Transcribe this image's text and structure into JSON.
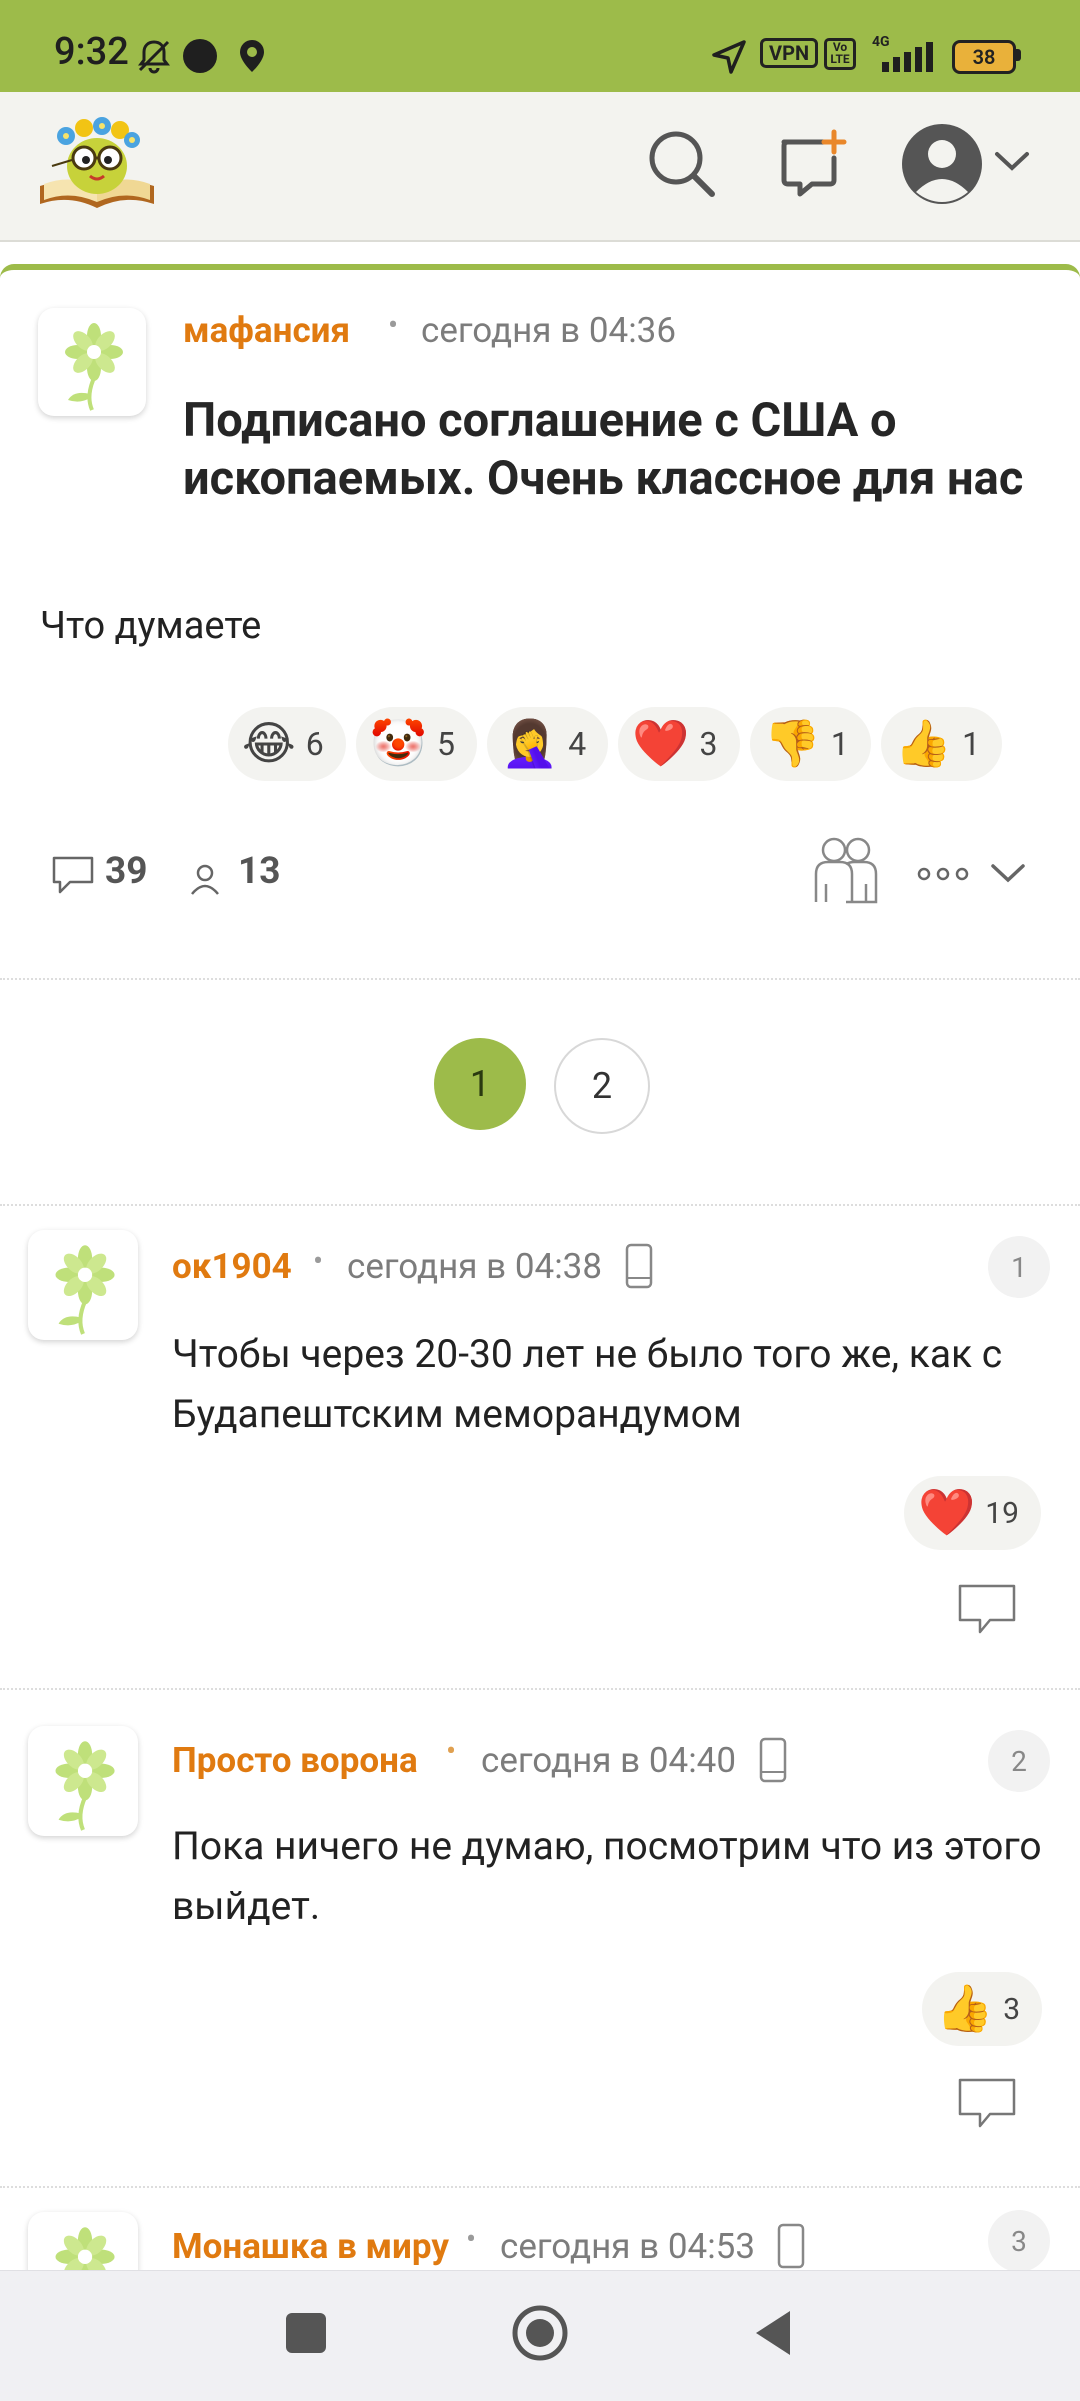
{
  "status_bar": {
    "time": "9:32",
    "vpn": "VPN",
    "volte": "Vo LTE",
    "network": "4G",
    "battery": "38"
  },
  "post": {
    "author": "мафансия",
    "time": "сегодня в 04:36",
    "title": "Подписано соглашение с США о ископаемых. Очень классное для нас",
    "body": "Что думаете",
    "reactions": [
      {
        "emoji": "😂",
        "count": "6"
      },
      {
        "emoji": "🤡",
        "count": "5"
      },
      {
        "emoji": "🤦‍♀️",
        "count": "4"
      },
      {
        "emoji": "❤️",
        "count": "3"
      },
      {
        "emoji": "👎",
        "count": "1"
      },
      {
        "emoji": "👍",
        "count": "1"
      }
    ],
    "comments_count": "39",
    "subscribers_count": "13"
  },
  "pagination": {
    "pages": [
      "1",
      "2"
    ],
    "current": "1"
  },
  "comments": [
    {
      "author": "ок1904",
      "time": "сегодня в 04:38",
      "number": "1",
      "text": "Чтобы через 20-30 лет не было того же, как с Будапештским меморандумом",
      "reaction_emoji": "❤️",
      "reaction_count": "19"
    },
    {
      "author": "Просто ворона",
      "time": "сегодня в 04:40",
      "number": "2",
      "text": "Пока ничего не думаю, посмотрим что из этого выйдет.",
      "reaction_emoji": "👍",
      "reaction_count": "3"
    },
    {
      "author": "Монашка в миру",
      "time": "сегодня в 04:53",
      "number": "3"
    }
  ],
  "colors": {
    "accent": "#9dbb4a",
    "author": "#e07a10"
  }
}
